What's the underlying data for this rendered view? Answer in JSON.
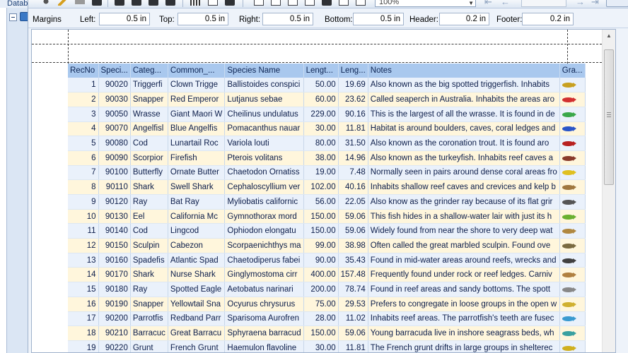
{
  "left_tab": "Datab",
  "toolbar": {
    "zoom": "100%"
  },
  "margins": {
    "label": "Margins",
    "fields": [
      {
        "label": "Left:",
        "value": "0.5 in"
      },
      {
        "label": "Top:",
        "value": "0.5 in"
      },
      {
        "label": "Right:",
        "value": "0.5 in"
      },
      {
        "label": "Bottom:",
        "value": "0.5 in"
      },
      {
        "label": "Header:",
        "value": "0.2 in"
      },
      {
        "label": "Footer:",
        "value": "0.2 in"
      }
    ]
  },
  "table": {
    "columns": [
      "RecNo",
      "Speci...",
      "Categ...",
      "Common_...",
      "Species Name",
      "Lengt...",
      "Leng...",
      "Notes",
      "Gra..."
    ],
    "rows": [
      [
        "1",
        "90020",
        "Triggerfi",
        "Clown Trigge",
        "Ballistoides conspici",
        "50.00",
        "19.69",
        "Also known as the big spotted triggerfish.  Inhabits"
      ],
      [
        "2",
        "90030",
        "Snapper",
        "Red Emperor",
        "Lutjanus sebae",
        "60.00",
        "23.62",
        "Called seaperch in Australia.  Inhabits the areas aro"
      ],
      [
        "3",
        "90050",
        "Wrasse",
        "Giant Maori W",
        "Cheilinus undulatus",
        "229.00",
        "90.16",
        "This is the largest of all the wrasse.  It is found in de"
      ],
      [
        "4",
        "90070",
        "Angelfisl",
        "Blue Angelfis",
        "Pomacanthus nauar",
        "30.00",
        "11.81",
        "Habitat is around boulders, caves, coral ledges and"
      ],
      [
        "5",
        "90080",
        "Cod",
        "Lunartail Roc",
        "Variola louti",
        "80.00",
        "31.50",
        "Also known as the coronation trout.  It is found aro"
      ],
      [
        "6",
        "90090",
        "Scorpior",
        "Firefish",
        "Pterois volitans",
        "38.00",
        "14.96",
        "Also known as the turkeyfish.  Inhabits reef caves a"
      ],
      [
        "7",
        "90100",
        "Butterfly",
        "Ornate Butter",
        "Chaetodon Ornatiss",
        "19.00",
        "7.48",
        "Normally seen in pairs around dense coral areas fro"
      ],
      [
        "8",
        "90110",
        "Shark",
        "Swell Shark",
        "Cephaloscyllium ver",
        "102.00",
        "40.16",
        "Inhabits shallow reef caves and crevices and kelp b"
      ],
      [
        "9",
        "90120",
        "Ray",
        "Bat Ray",
        "Myliobatis californic",
        "56.00",
        "22.05",
        "Also know as the grinder ray because of its flat grir"
      ],
      [
        "10",
        "90130",
        "Eel",
        "California Mc",
        "Gymnothorax mord",
        "150.00",
        "59.06",
        "This fish hides in a shallow-water lair with just its h"
      ],
      [
        "11",
        "90140",
        "Cod",
        "Lingcod",
        "Ophiodon elongatu",
        "150.00",
        "59.06",
        "Widely found from near the shore to very deep wat"
      ],
      [
        "12",
        "90150",
        "Sculpin",
        "Cabezon",
        "Scorpaenichthys ma",
        "99.00",
        "38.98",
        "Often called the great marbled sculpin.  Found ove"
      ],
      [
        "13",
        "90160",
        "Spadefis",
        "Atlantic Spad",
        "Chaetodiperus fabei",
        "90.00",
        "35.43",
        "Found in mid-water areas around reefs, wrecks and"
      ],
      [
        "14",
        "90170",
        "Shark",
        "Nurse Shark",
        "Ginglymostoma cirr",
        "400.00",
        "157.48",
        "Frequently found under rock or reef ledges.  Carniv"
      ],
      [
        "15",
        "90180",
        "Ray",
        "Spotted Eagle",
        "Aetobatus narinari",
        "200.00",
        "78.74",
        "Found in reef areas and sandy bottoms.  The spott"
      ],
      [
        "16",
        "90190",
        "Snapper",
        "Yellowtail Sna",
        "Ocyurus chrysurus",
        "75.00",
        "29.53",
        "Prefers to congregate in loose groups in the open w"
      ],
      [
        "17",
        "90200",
        "Parrotfis",
        "Redband Parr",
        "Sparisoma Aurofren",
        "28.00",
        "11.02",
        "Inhabits reef areas.  The parrotfish's teeth are fusec"
      ],
      [
        "18",
        "90210",
        "Barracuc",
        "Great Barracu",
        "Sphyraena barracud",
        "150.00",
        "59.06",
        "Young barracuda live in inshore seagrass beds, wh"
      ],
      [
        "19",
        "90220",
        "Grunt",
        "French Grunt",
        "Haemulon flavoline",
        "30.00",
        "11.81",
        "The French grunt drifts in large groups in shelterec"
      ]
    ],
    "fish_colors": [
      "#c8a020",
      "#d23030",
      "#3aa84a",
      "#2a55c8",
      "#b82020",
      "#8a3a2a",
      "#e0c020",
      "#a07840",
      "#555555",
      "#6ab030",
      "#b08840",
      "#7a6a40",
      "#404040",
      "#b08040",
      "#888888",
      "#d0b030",
      "#3a9ad0",
      "#3aa0a0",
      "#d0b020"
    ]
  }
}
